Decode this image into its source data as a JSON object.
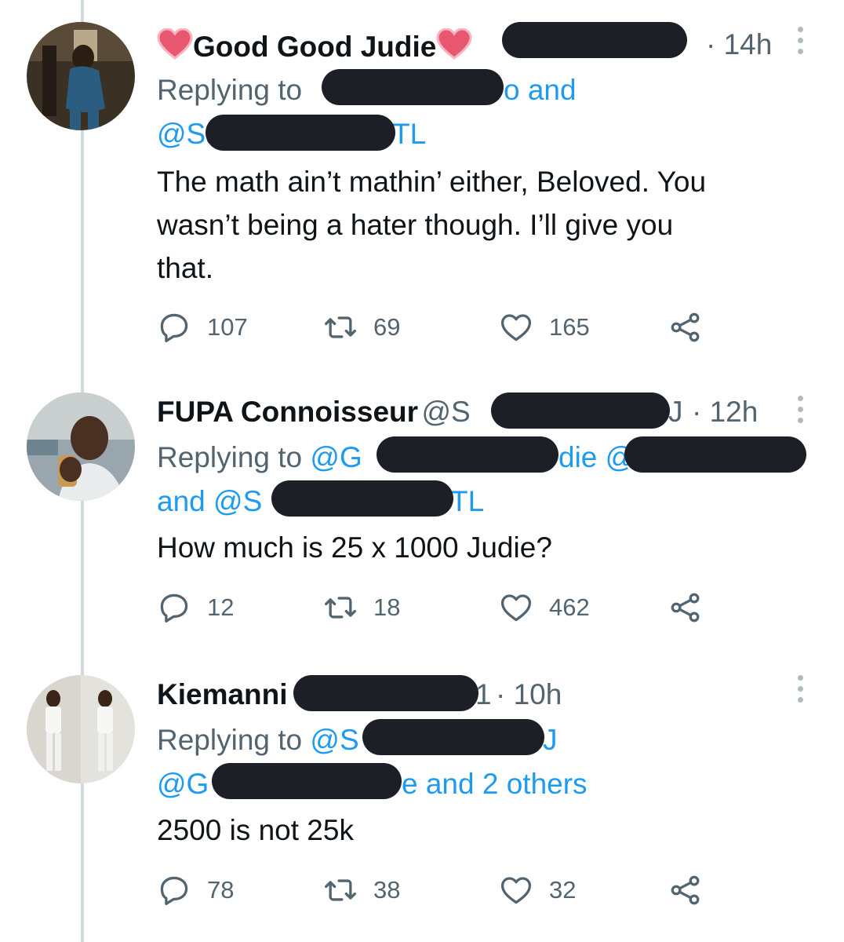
{
  "tweets": [
    {
      "name": "Good Good Judie",
      "name_emoji": "heart-emoji",
      "time": "· 14h",
      "reply_prefix": "Replying to",
      "reply_line1_tail": "o and",
      "reply_line2_start": "@Sa",
      "reply_line2_tail": "TL",
      "text_lines": [
        "The math ain’t mathin’ either, Beloved. You",
        "wasn’t being a hater though. I’ll give you",
        "that."
      ],
      "actions": {
        "replies": "107",
        "retweets": "69",
        "likes": "165"
      }
    },
    {
      "name": "FUPA Connoisseur",
      "handle_start": "@S",
      "handle_tail": "J",
      "time": "· 12h",
      "reply_prefix": "Replying to",
      "reply_line1_start": "@G",
      "reply_line1_mid": "die @",
      "reply_line2_start": "and @S",
      "reply_line2_tail": "TL",
      "text_lines": [
        "How much is 25 x 1000 Judie?"
      ],
      "actions": {
        "replies": "12",
        "retweets": "18",
        "likes": "462"
      }
    },
    {
      "name": "Kiemanni",
      "handle_tail": "1",
      "time": "· 10h",
      "reply_prefix": "Replying to",
      "reply_line1_start": "@S",
      "reply_line1_tail": "J",
      "reply_line2_start": "@G",
      "reply_line2_tail": "e and 2 others",
      "text_lines": [
        "2500 is not 25k"
      ],
      "actions": {
        "replies": "78",
        "retweets": "38",
        "likes": "32"
      }
    }
  ],
  "colors": {
    "link": "#1d9bf0",
    "muted": "#536471",
    "thread_line": "#cfd9de",
    "redaction": "#1c1f26"
  },
  "icons": [
    "reply-icon",
    "retweet-icon",
    "like-icon",
    "share-icon",
    "more-icon",
    "heart-emoji"
  ]
}
